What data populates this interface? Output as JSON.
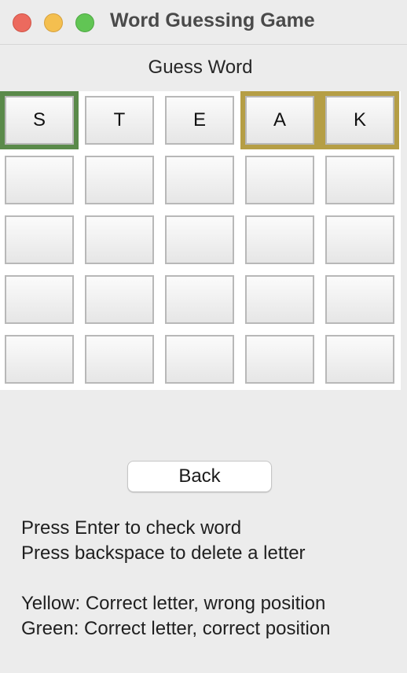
{
  "window": {
    "title": "Word Guessing Game"
  },
  "subtitle": "Guess Word",
  "grid": {
    "rows": [
      [
        {
          "letter": "S",
          "status": "green"
        },
        {
          "letter": "T",
          "status": "none"
        },
        {
          "letter": "E",
          "status": "none"
        },
        {
          "letter": "A",
          "status": "yellow"
        },
        {
          "letter": "K",
          "status": "yellow"
        }
      ],
      [
        {
          "letter": "",
          "status": "none"
        },
        {
          "letter": "",
          "status": "none"
        },
        {
          "letter": "",
          "status": "none"
        },
        {
          "letter": "",
          "status": "none"
        },
        {
          "letter": "",
          "status": "none"
        }
      ],
      [
        {
          "letter": "",
          "status": "none"
        },
        {
          "letter": "",
          "status": "none"
        },
        {
          "letter": "",
          "status": "none"
        },
        {
          "letter": "",
          "status": "none"
        },
        {
          "letter": "",
          "status": "none"
        }
      ],
      [
        {
          "letter": "",
          "status": "none"
        },
        {
          "letter": "",
          "status": "none"
        },
        {
          "letter": "",
          "status": "none"
        },
        {
          "letter": "",
          "status": "none"
        },
        {
          "letter": "",
          "status": "none"
        }
      ],
      [
        {
          "letter": "",
          "status": "none"
        },
        {
          "letter": "",
          "status": "none"
        },
        {
          "letter": "",
          "status": "none"
        },
        {
          "letter": "",
          "status": "none"
        },
        {
          "letter": "",
          "status": "none"
        }
      ]
    ]
  },
  "back_button": "Back",
  "instructions": {
    "line1": "Press Enter to check word",
    "line2": "Press backspace to delete a letter",
    "line3": "Yellow: Correct letter, wrong position",
    "line4": "Green: Correct letter, correct position"
  },
  "colors": {
    "green": "#5a8a4a",
    "yellow": "#b59e45"
  }
}
